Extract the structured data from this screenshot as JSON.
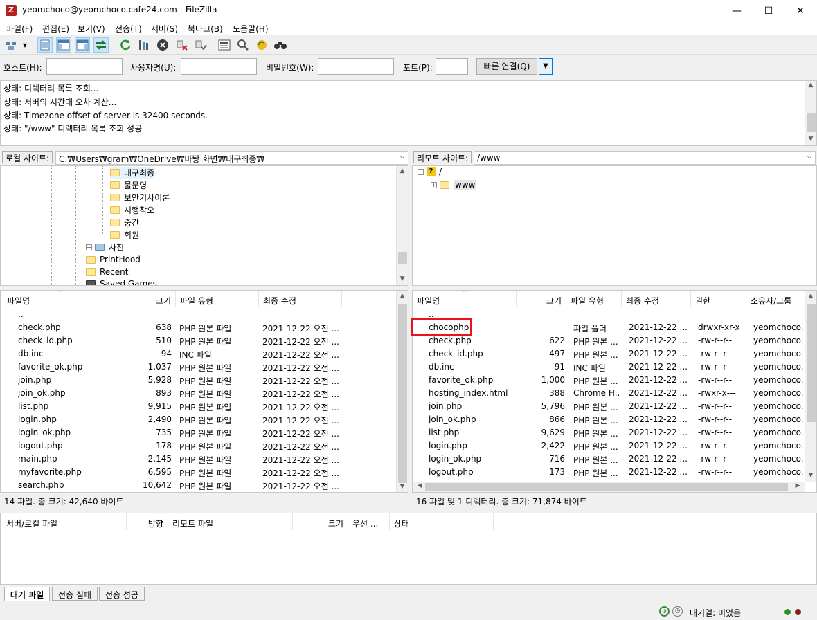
{
  "window": {
    "title": "yeomchoco@yeomchoco.cafe24.com - FileZilla",
    "min": "—",
    "max": "☐",
    "close": "✕"
  },
  "menu": [
    "파일(F)",
    "편집(E)",
    "보기(V)",
    "전송(T)",
    "서버(S)",
    "북마크(B)",
    "도움말(H)"
  ],
  "quickconnect": {
    "host_label": "호스트(H):",
    "user_label": "사용자명(U):",
    "pass_label": "비밀번호(W):",
    "port_label": "포트(P):",
    "host": "",
    "user": "",
    "pass": "",
    "port": "",
    "connect_label": "빠른 연결(Q)"
  },
  "log": [
    "상태: 디렉터리 목록 조회...",
    "상태: 서버의 시간대 오차 계산...",
    "상태: Timezone offset of server is 32400 seconds.",
    "상태: \"/www\" 디렉터리 목록 조회 성공"
  ],
  "local": {
    "label": "로컬 사이트:",
    "path": "C:₩Users₩gram₩OneDrive₩바탕 화면₩대구최종₩",
    "tree": [
      "대구최종",
      "물문명",
      "보안기사이론",
      "시행착오",
      "중간",
      "회원",
      "사진",
      "PrintHood",
      "Recent",
      "Saved Games"
    ],
    "headers": [
      "파일명",
      "크기",
      "파일 유형",
      "최종 수정"
    ],
    "files": [
      {
        "name": "..",
        "size": "",
        "type": "",
        "mod": "",
        "icon": "dir"
      },
      {
        "name": "check.php",
        "size": "638",
        "type": "PHP 원본 파일",
        "mod": "2021-12-22 오전 ...",
        "icon": "php"
      },
      {
        "name": "check_id.php",
        "size": "510",
        "type": "PHP 원본 파일",
        "mod": "2021-12-22 오전 ...",
        "icon": "php"
      },
      {
        "name": "db.inc",
        "size": "94",
        "type": "INC 파일",
        "mod": "2021-12-22 오전 ...",
        "icon": "file"
      },
      {
        "name": "favorite_ok.php",
        "size": "1,037",
        "type": "PHP 원본 파일",
        "mod": "2021-12-22 오전 ...",
        "icon": "php"
      },
      {
        "name": "join.php",
        "size": "5,928",
        "type": "PHP 원본 파일",
        "mod": "2021-12-22 오전 ...",
        "icon": "php"
      },
      {
        "name": "join_ok.php",
        "size": "893",
        "type": "PHP 원본 파일",
        "mod": "2021-12-22 오전 ...",
        "icon": "php"
      },
      {
        "name": "list.php",
        "size": "9,915",
        "type": "PHP 원본 파일",
        "mod": "2021-12-22 오전 ...",
        "icon": "php"
      },
      {
        "name": "login.php",
        "size": "2,490",
        "type": "PHP 원본 파일",
        "mod": "2021-12-22 오전 ...",
        "icon": "php"
      },
      {
        "name": "login_ok.php",
        "size": "735",
        "type": "PHP 원본 파일",
        "mod": "2021-12-22 오전 ...",
        "icon": "php"
      },
      {
        "name": "logout.php",
        "size": "178",
        "type": "PHP 원본 파일",
        "mod": "2021-12-22 오전 ...",
        "icon": "php"
      },
      {
        "name": "main.php",
        "size": "2,145",
        "type": "PHP 원본 파일",
        "mod": "2021-12-22 오전 ...",
        "icon": "php"
      },
      {
        "name": "myfavorite.php",
        "size": "6,595",
        "type": "PHP 원본 파일",
        "mod": "2021-12-22 오전 ...",
        "icon": "php"
      },
      {
        "name": "search.php",
        "size": "10,642",
        "type": "PHP 원본 파일",
        "mod": "2021-12-22 오전 ...",
        "icon": "php"
      }
    ],
    "status": "14 파일. 총 크기: 42,640 바이트"
  },
  "remote": {
    "label": "리모트 사이트:",
    "path": "/www",
    "tree": [
      "/",
      "www"
    ],
    "headers": [
      "파일명",
      "크기",
      "파일 유형",
      "최종 수정",
      "권한",
      "소유자/그룹"
    ],
    "files": [
      {
        "name": "..",
        "size": "",
        "type": "",
        "mod": "",
        "perm": "",
        "owner": "",
        "icon": "dir"
      },
      {
        "name": "chocophp",
        "size": "",
        "type": "파일 폴더",
        "mod": "2021-12-22 ...",
        "perm": "drwxr-xr-x",
        "owner": "yeomchoco...",
        "icon": "dir"
      },
      {
        "name": "check.php",
        "size": "622",
        "type": "PHP 원본 ...",
        "mod": "2021-12-22 ...",
        "perm": "-rw-r--r--",
        "owner": "yeomchoco...",
        "icon": "php"
      },
      {
        "name": "check_id.php",
        "size": "497",
        "type": "PHP 원본 ...",
        "mod": "2021-12-22 ...",
        "perm": "-rw-r--r--",
        "owner": "yeomchoco...",
        "icon": "php"
      },
      {
        "name": "db.inc",
        "size": "91",
        "type": "INC 파일",
        "mod": "2021-12-22 ...",
        "perm": "-rw-r--r--",
        "owner": "yeomchoco...",
        "icon": "file"
      },
      {
        "name": "favorite_ok.php",
        "size": "1,000",
        "type": "PHP 원본 ...",
        "mod": "2021-12-22 ...",
        "perm": "-rw-r--r--",
        "owner": "yeomchoco...",
        "icon": "php"
      },
      {
        "name": "hosting_index.html",
        "size": "388",
        "type": "Chrome H...",
        "mod": "2021-12-22 ...",
        "perm": "-rwxr-x---",
        "owner": "yeomchoco...",
        "icon": "chrome"
      },
      {
        "name": "join.php",
        "size": "5,796",
        "type": "PHP 원본 ...",
        "mod": "2021-12-22 ...",
        "perm": "-rw-r--r--",
        "owner": "yeomchoco...",
        "icon": "php"
      },
      {
        "name": "join_ok.php",
        "size": "866",
        "type": "PHP 원본 ...",
        "mod": "2021-12-22 ...",
        "perm": "-rw-r--r--",
        "owner": "yeomchoco...",
        "icon": "php"
      },
      {
        "name": "list.php",
        "size": "9,629",
        "type": "PHP 원본 ...",
        "mod": "2021-12-22 ...",
        "perm": "-rw-r--r--",
        "owner": "yeomchoco...",
        "icon": "php"
      },
      {
        "name": "login.php",
        "size": "2,422",
        "type": "PHP 원본 ...",
        "mod": "2021-12-22 ...",
        "perm": "-rw-r--r--",
        "owner": "yeomchoco...",
        "icon": "php"
      },
      {
        "name": "login_ok.php",
        "size": "716",
        "type": "PHP 원본 ...",
        "mod": "2021-12-22 ...",
        "perm": "-rw-r--r--",
        "owner": "yeomchoco...",
        "icon": "php"
      },
      {
        "name": "logout.php",
        "size": "173",
        "type": "PHP 원본 ...",
        "mod": "2021-12-22 ...",
        "perm": "-rw-r--r--",
        "owner": "yeomchoco...",
        "icon": "php"
      }
    ],
    "status": "16 파일 및 1 디렉터리. 총 크기: 71,874 바이트"
  },
  "queue": {
    "headers": [
      "서버/로컬 파일",
      "방향",
      "리모트 파일",
      "크기",
      "우선 ...",
      "상태"
    ],
    "tabs": [
      "대기 파일",
      "전송 실패",
      "전송 성공"
    ]
  },
  "statusbar": {
    "queue": "대기열: 비었음"
  },
  "colors": {
    "highlight_box": "#e8131e",
    "folder": "#ffe699",
    "selection": "#cce4f7"
  }
}
